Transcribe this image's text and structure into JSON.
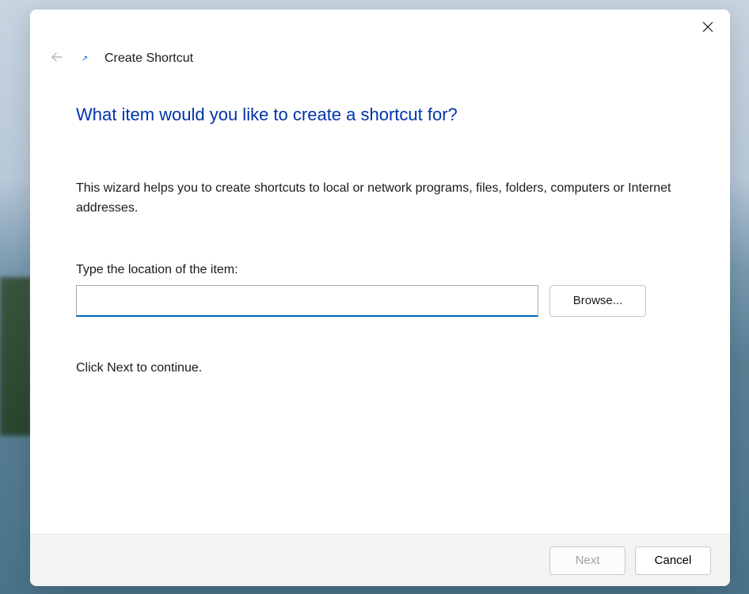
{
  "header": {
    "title": "Create Shortcut"
  },
  "main": {
    "heading": "What item would you like to create a shortcut for?",
    "description": "This wizard helps you to create shortcuts to local or network programs, files, folders, computers or Internet addresses.",
    "input_label": "Type the location of the item:",
    "input_value": "",
    "browse_label": "Browse...",
    "continue_text": "Click Next to continue."
  },
  "footer": {
    "next_label": "Next",
    "cancel_label": "Cancel"
  }
}
